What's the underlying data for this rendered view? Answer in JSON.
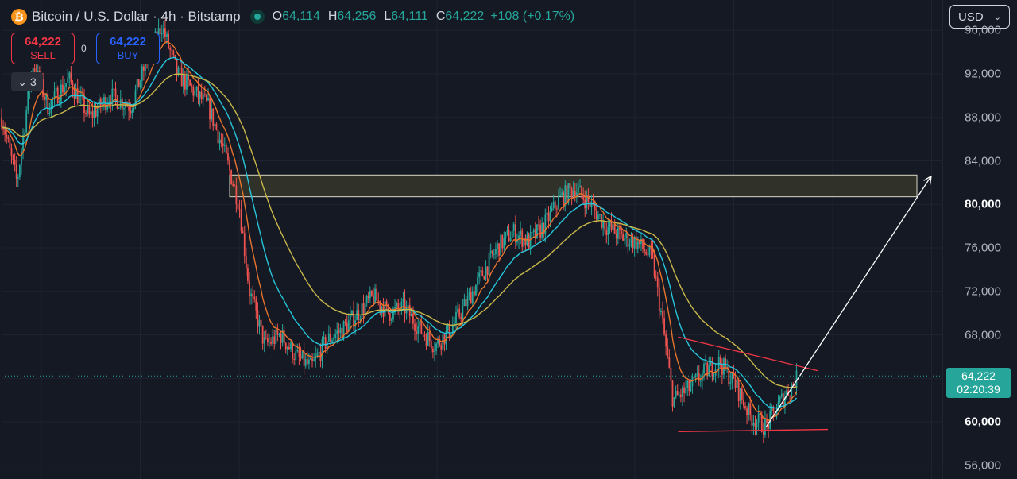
{
  "header": {
    "symbol_icon": "bitcoin-icon",
    "symbol_icon_glyph": "₿",
    "title": "Bitcoin / U.S. Dollar · 4h · Bitstamp",
    "open_label": "O",
    "open": "64,114",
    "high_label": "H",
    "high": "64,256",
    "low_label": "L",
    "low": "64,111",
    "close_label": "C",
    "close": "64,222",
    "change": "+108 (+0.17%)"
  },
  "trade": {
    "sell_price": "64,222",
    "sell_label": "SELL",
    "spread": "0",
    "buy_price": "64,222",
    "buy_label": "BUY"
  },
  "indicators_toggle": {
    "icon": "chevron-down-icon",
    "glyph": "⌄",
    "count": "3"
  },
  "currency": {
    "value": "USD",
    "icon": "chevron-down-icon",
    "glyph": "⌄"
  },
  "last_price_tag": {
    "price": "64,222",
    "countdown": "02:20:39"
  },
  "colors": {
    "background": "#151924",
    "up": "#26a69a",
    "down": "#ef5350",
    "ema_fast": "#e8732c",
    "ema_mid": "#26c6da",
    "ema_slow": "#c9b84a",
    "zone_fill": "#3a3a2a",
    "zone_border": "#d8d8c8",
    "trendline": "#f23645",
    "projection_arrow": "#ffffff"
  },
  "chart_data": {
    "type": "candlestick",
    "y_ticks": [
      "56,000",
      "60,000",
      "64,000",
      "68,000",
      "72,000",
      "76,000",
      "80,000",
      "84,000",
      "88,000",
      "92,000",
      "96,000"
    ],
    "y_ticks_bold": [
      "60,000",
      "80,000"
    ],
    "ylim": [
      55000,
      97500
    ],
    "last_price": 64222,
    "price_path": [
      {
        "x": 0,
        "y": 88000
      },
      {
        "x": 3,
        "y": 82000
      },
      {
        "x": 6,
        "y": 93000
      },
      {
        "x": 9,
        "y": 89000
      },
      {
        "x": 13,
        "y": 91500
      },
      {
        "x": 17,
        "y": 88000
      },
      {
        "x": 21,
        "y": 90000
      },
      {
        "x": 25,
        "y": 89000
      },
      {
        "x": 28,
        "y": 93000
      },
      {
        "x": 31,
        "y": 96500
      },
      {
        "x": 34,
        "y": 92000
      },
      {
        "x": 37,
        "y": 90500
      },
      {
        "x": 40,
        "y": 89000
      },
      {
        "x": 43,
        "y": 85000
      },
      {
        "x": 46,
        "y": 80000
      },
      {
        "x": 48,
        "y": 72000
      },
      {
        "x": 51,
        "y": 67000
      },
      {
        "x": 54,
        "y": 68000
      },
      {
        "x": 57,
        "y": 66000
      },
      {
        "x": 60,
        "y": 65000
      },
      {
        "x": 63,
        "y": 67500
      },
      {
        "x": 66,
        "y": 68500
      },
      {
        "x": 69,
        "y": 70000
      },
      {
        "x": 72,
        "y": 71500
      },
      {
        "x": 75,
        "y": 70000
      },
      {
        "x": 78,
        "y": 70500
      },
      {
        "x": 81,
        "y": 68500
      },
      {
        "x": 84,
        "y": 67000
      },
      {
        "x": 87,
        "y": 68500
      },
      {
        "x": 90,
        "y": 71000
      },
      {
        "x": 93,
        "y": 73500
      },
      {
        "x": 96,
        "y": 76000
      },
      {
        "x": 99,
        "y": 77500
      },
      {
        "x": 102,
        "y": 76500
      },
      {
        "x": 105,
        "y": 78000
      },
      {
        "x": 108,
        "y": 80500
      },
      {
        "x": 111,
        "y": 81500
      },
      {
        "x": 114,
        "y": 80000
      },
      {
        "x": 117,
        "y": 78000
      },
      {
        "x": 120,
        "y": 77000
      },
      {
        "x": 123,
        "y": 76500
      },
      {
        "x": 126,
        "y": 75000
      },
      {
        "x": 128,
        "y": 69000
      },
      {
        "x": 130,
        "y": 62000
      },
      {
        "x": 133,
        "y": 63000
      },
      {
        "x": 136,
        "y": 64500
      },
      {
        "x": 139,
        "y": 65500
      },
      {
        "x": 142,
        "y": 63500
      },
      {
        "x": 145,
        "y": 60500
      },
      {
        "x": 148,
        "y": 59500
      },
      {
        "x": 151,
        "y": 62000
      },
      {
        "x": 154,
        "y": 64000
      }
    ],
    "overlays": {
      "resistance_zone": {
        "y_from": 80700,
        "y_to": 82700
      },
      "upper_trendline": {
        "from": {
          "x": 131,
          "y": 67800
        },
        "to": {
          "x": 158,
          "y": 64700
        }
      },
      "lower_trendline": {
        "from": {
          "x": 131,
          "y": 59100
        },
        "to": {
          "x": 160,
          "y": 59300
        }
      },
      "projection_arrow": {
        "from": {
          "x": 148,
          "y": 59500
        },
        "to": {
          "x": 180,
          "y": 82600
        }
      }
    }
  }
}
